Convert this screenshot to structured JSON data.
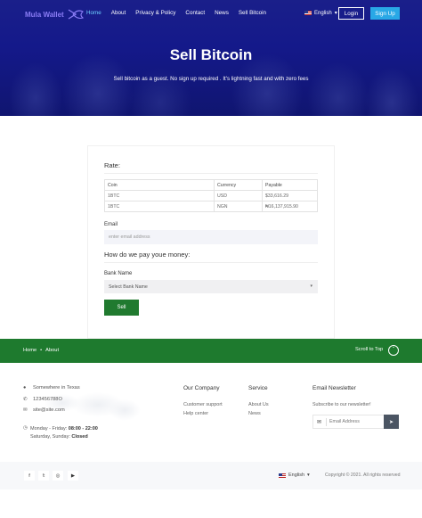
{
  "nav": {
    "logo": "Mula Wallet",
    "links": [
      "Home",
      "About",
      "Privacy & Policy",
      "Contact",
      "News",
      "Sell Bitcoin"
    ],
    "language": "English",
    "login": "Login",
    "signup": "Sign Up"
  },
  "hero": {
    "title": "Sell Bitcoin",
    "subtitle": "Sell bitcoin as a guest. No sign up required . It's lightning fast and with zero fees"
  },
  "form": {
    "rate_label": "Rate:",
    "table": {
      "headers": [
        "Coin",
        "Currency",
        "Payable"
      ],
      "rows": [
        [
          "1BTC",
          "USD",
          "$33,616.29"
        ],
        [
          "1BTC",
          "NGN",
          "₦16,137,915.90"
        ]
      ]
    },
    "email_label": "Email",
    "email_placeholder": "enter email address",
    "pay_title": "How do we pay youe money:",
    "bank_label": "Bank Name",
    "bank_selected": "Select Bank Name",
    "sell_label": "Sell"
  },
  "breadcrumb": {
    "home": "Home",
    "sep": "•",
    "current": "About",
    "scroll_top": "Scroll to Top"
  },
  "footer": {
    "address": "Somewhere in Texas",
    "phone": "123456788O",
    "email": "site@site.com",
    "hours_line1_prefix": "Monday - Friday:",
    "hours_line1_bold": "08:00 - 22:00",
    "hours_line2_prefix": "Saturday, Sunday:",
    "hours_line2_bold": "Closed",
    "company_title": "Our Company",
    "company_links": [
      "Customer support",
      "Help center"
    ],
    "service_title": "Service",
    "service_links": [
      "About Us",
      "News"
    ],
    "newsletter_title": "Email Newsletter",
    "newsletter_sub": "Subscribe to our newsletter!",
    "newsletter_placeholder": "Email Address",
    "language": "English",
    "copyright": "Copyright © 2021. All rights reserved"
  },
  "colors": {
    "hero": "#14198a",
    "green": "#1e7a2e",
    "signup": "#29a8e6"
  }
}
